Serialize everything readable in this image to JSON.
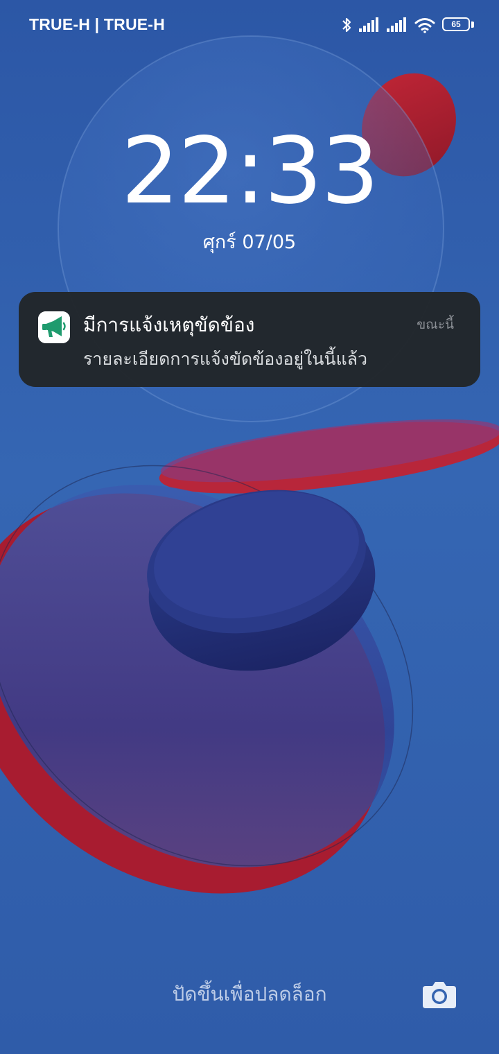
{
  "status_bar": {
    "carrier": "TRUE-H | TRUE-H",
    "battery_level": "65",
    "icons": [
      "bluetooth-icon",
      "signal-icon",
      "signal-icon",
      "wifi-icon",
      "battery-icon"
    ]
  },
  "lock": {
    "time_hours": "22",
    "time_sep": ":",
    "time_minutes": "33",
    "date": "ศุกร์ 07/05"
  },
  "notification": {
    "app_icon": "megaphone-icon",
    "title": "มีการแจ้งเหตุขัดข้อง",
    "time": "ขณะนี้",
    "body": "รายละเอียดการแจ้งขัดข้องอยู่ในนี้แล้ว"
  },
  "bottom": {
    "unlock_hint": "ปัดขึ้นเพื่อปลดล็อก",
    "camera_icon": "camera-icon"
  },
  "colors": {
    "wallpaper_blue": "#2f5fae",
    "accent_red": "#c21f35",
    "notification_bg": "#212529",
    "app_icon_green": "#1f9b6e"
  }
}
